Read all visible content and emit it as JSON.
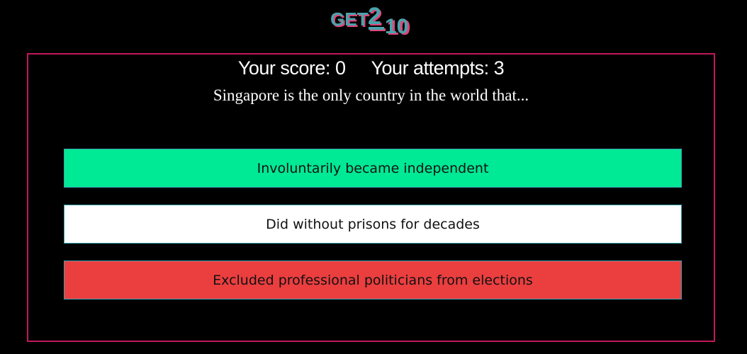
{
  "header": {
    "logo_text": "GET2_10"
  },
  "score": {
    "score_label": "Your score:",
    "score_value": "0",
    "attempts_label": "Your attempts:",
    "attempts_value": "3"
  },
  "question": {
    "text": "Singapore is the only country in the world that..."
  },
  "answers": [
    {
      "label": "Involuntarily became independent",
      "state": "correct",
      "color": "#00e994"
    },
    {
      "label": "Did without prisons for decades",
      "state": "neutral",
      "color": "#ffffff"
    },
    {
      "label": "Excluded professional politicians from elections",
      "state": "wrong",
      "color": "#eb3e3f"
    }
  ],
  "colors": {
    "background": "#000000",
    "frame_border": "#c2185b",
    "button_border": "#3aa2b0",
    "logo_teal": "#4aa3ab",
    "logo_pink": "#e0457b"
  }
}
